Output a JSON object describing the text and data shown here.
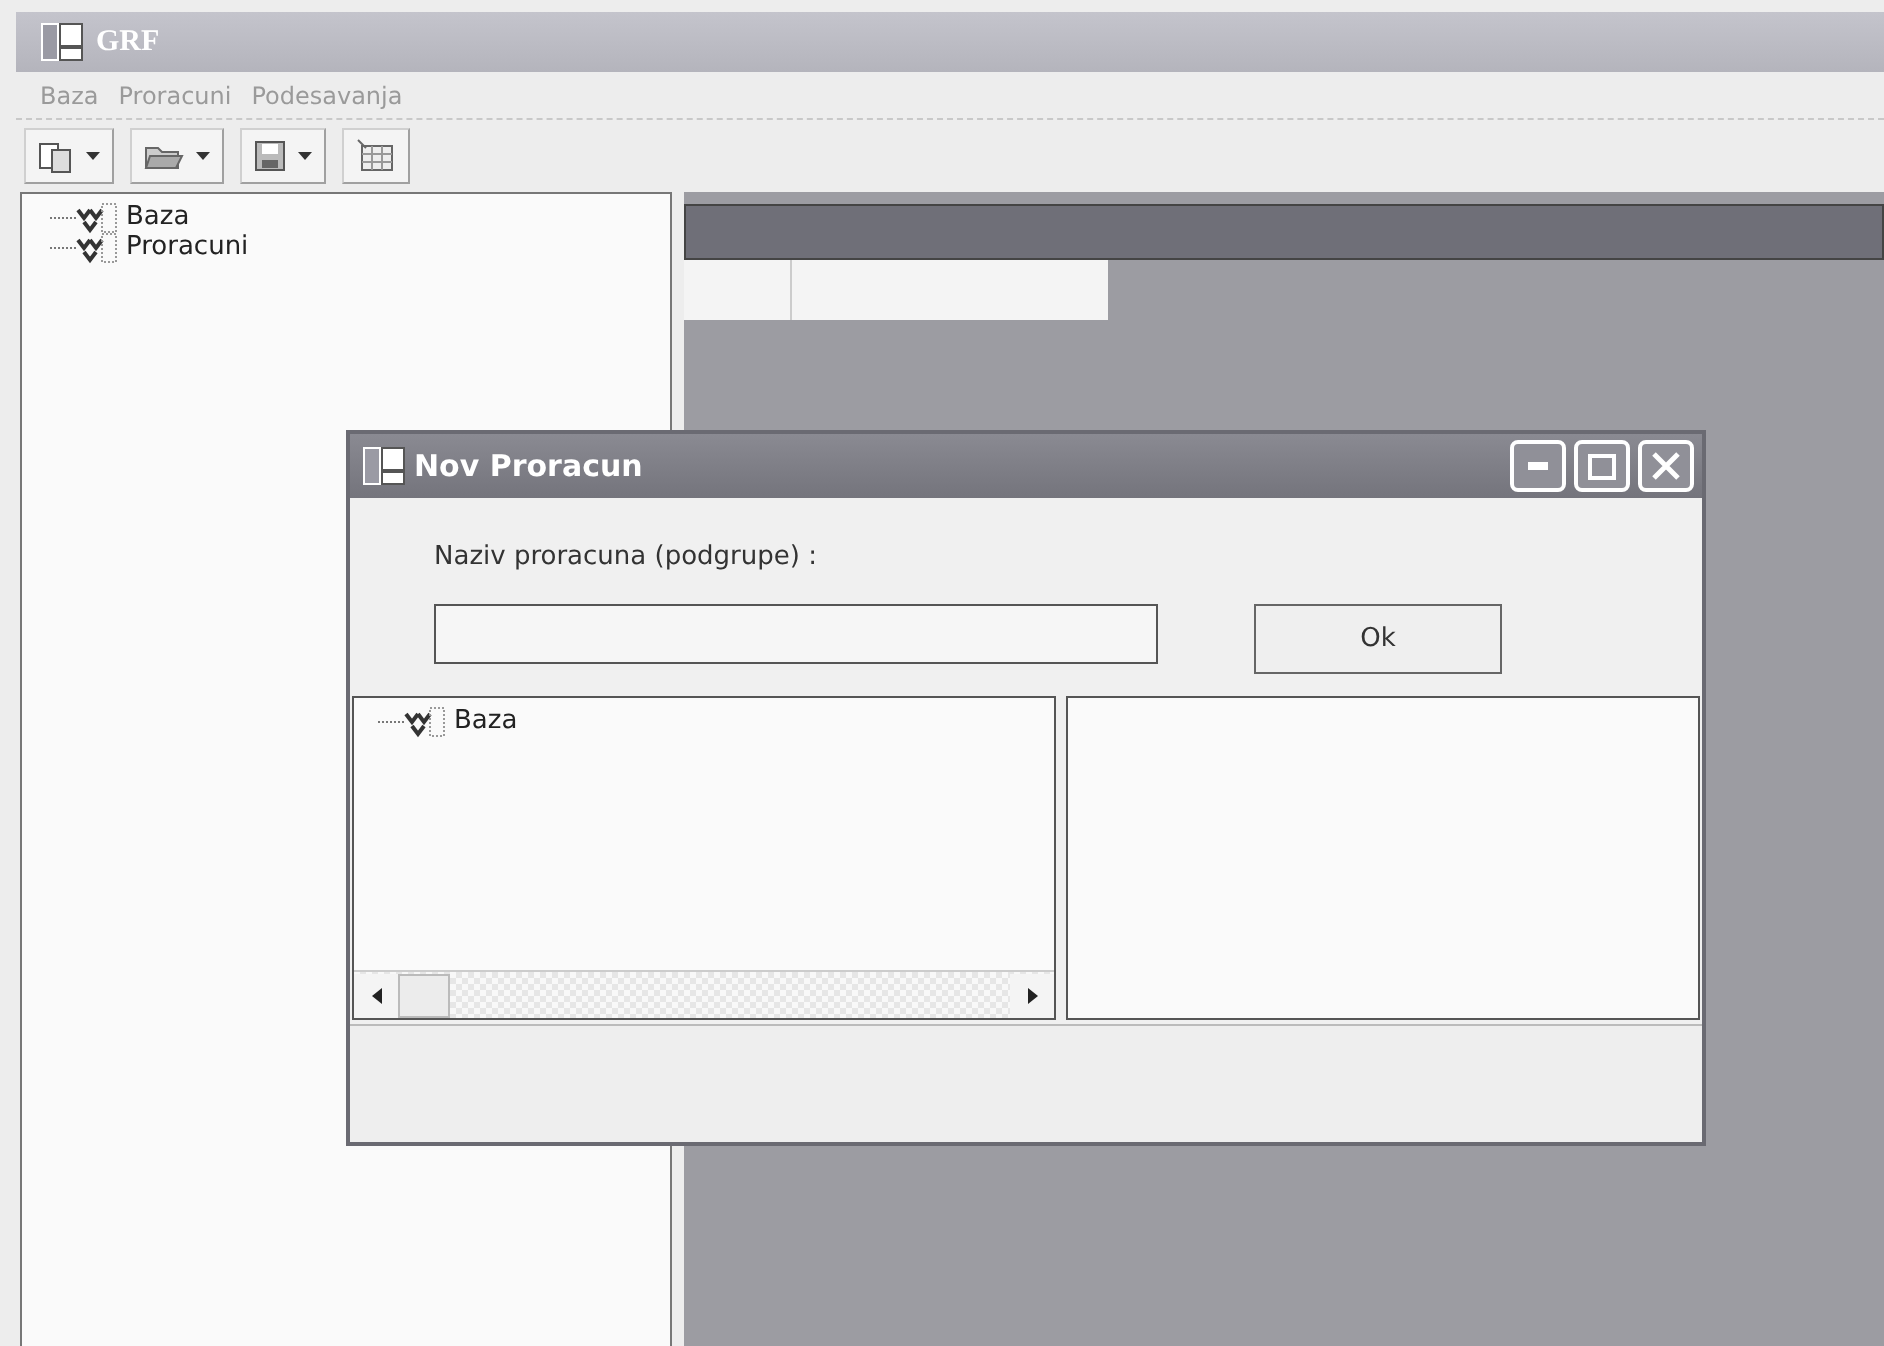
{
  "window": {
    "title": "GRF"
  },
  "menu": [
    {
      "label": "Baza"
    },
    {
      "label": "Proracuni"
    },
    {
      "label": "Podesavanja"
    }
  ],
  "toolbar": [
    {
      "kind": "split"
    },
    {
      "kind": "split"
    },
    {
      "kind": "split"
    },
    {
      "kind": "button"
    }
  ],
  "tree": [
    {
      "label": "Baza"
    },
    {
      "label": "Proracuni"
    }
  ],
  "dialog": {
    "title": "Nov Proracun",
    "label": "Naziv proracuna (podgrupe) :",
    "ok_button": "Ok",
    "tree": [
      {
        "label": "Baza"
      }
    ]
  }
}
